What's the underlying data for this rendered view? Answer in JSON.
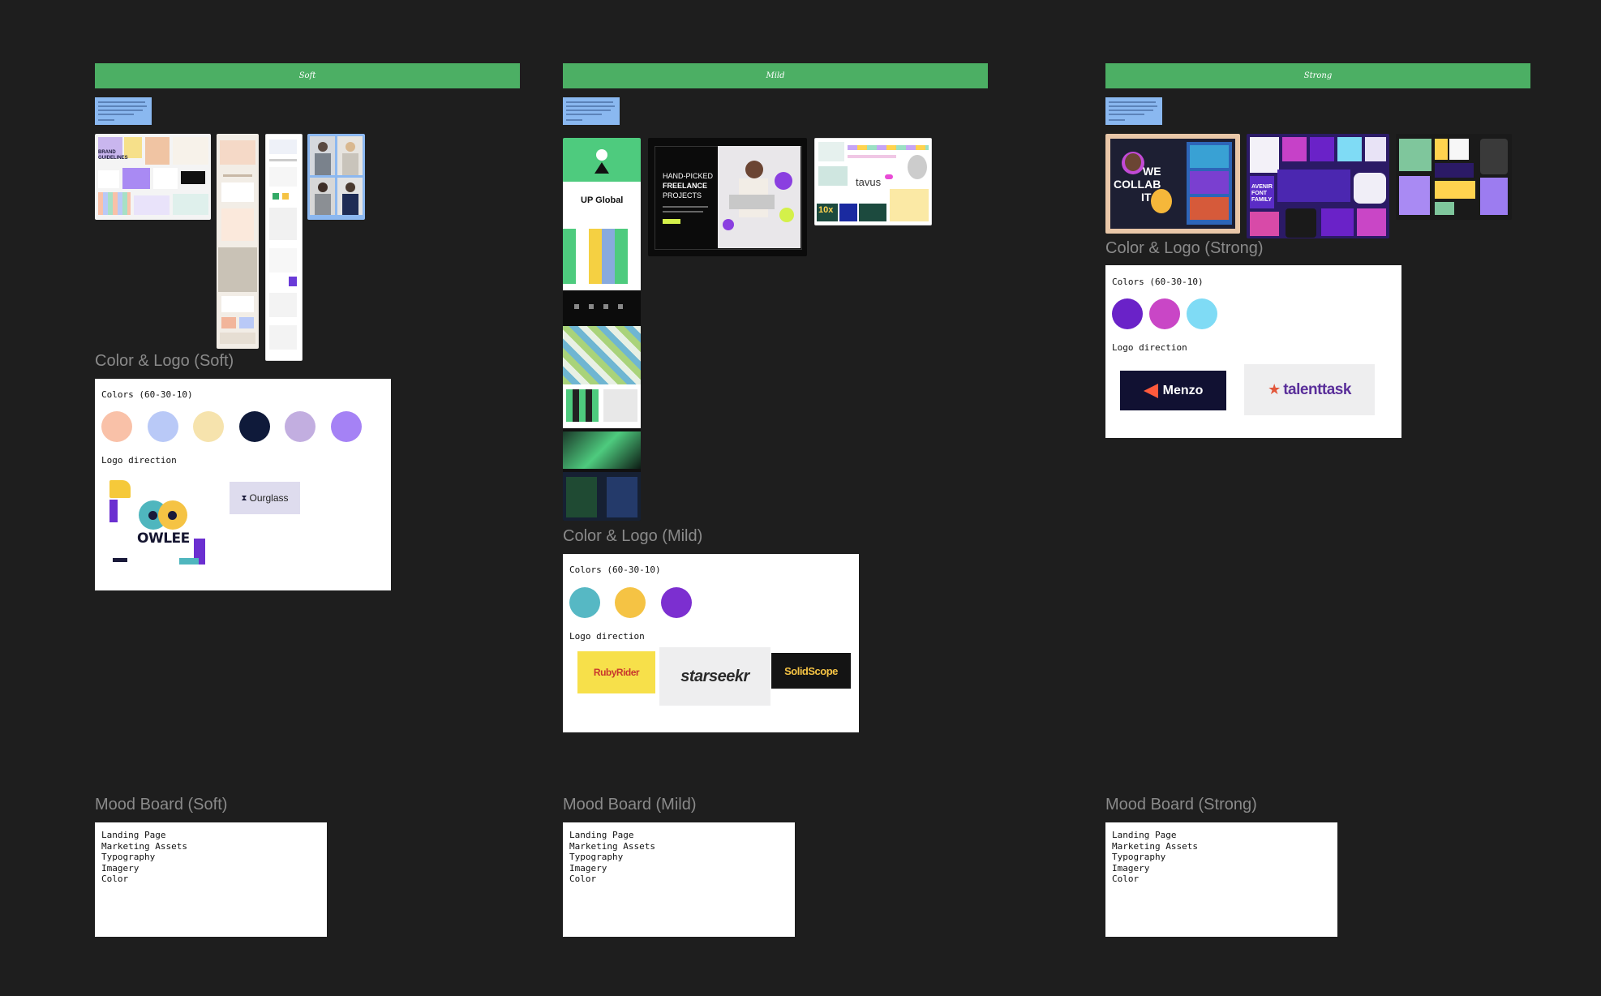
{
  "columns": [
    {
      "banner": "Soft",
      "color_logo_title": "Color & Logo (Soft)",
      "colors_label": "Colors (60-30-10)",
      "logo_label": "Logo direction",
      "colors": [
        "#f9c1a8",
        "#b9c9f7",
        "#f6e3ad",
        "#0f1a3a",
        "#c2aee0",
        "#a582f5"
      ],
      "logos": [
        "OWLEE",
        "Ourglass"
      ],
      "mood_title": "Mood Board (Soft)",
      "mood_items": [
        "Landing Page",
        "Marketing Assets",
        "Typography",
        "Imagery",
        "Color"
      ]
    },
    {
      "banner": "Mild",
      "color_logo_title": "Color & Logo (Mild)",
      "colors_label": "Colors (60-30-10)",
      "logo_label": "Logo direction",
      "colors": [
        "#56b8c4",
        "#f5c344",
        "#7c2fd0"
      ],
      "logos": [
        "RubyRider",
        "starseekr",
        "SolidScope"
      ],
      "mood_title": "Mood Board (Mild)",
      "mood_items": [
        "Landing Page",
        "Marketing Assets",
        "Typography",
        "Imagery",
        "Color"
      ]
    },
    {
      "banner": "Strong",
      "color_logo_title": "Color & Logo (Strong)",
      "colors_label": "Colors (60-30-10)",
      "logo_label": "Logo direction",
      "colors": [
        "#6a22c8",
        "#c946c6",
        "#7fdbf5"
      ],
      "logos": [
        "Menzo",
        "talenttask"
      ],
      "mood_title": "Mood Board (Strong)",
      "mood_items": [
        "Landing Page",
        "Marketing Assets",
        "Typography",
        "Imagery",
        "Color"
      ]
    }
  ],
  "thumb_text": {
    "brand_guidelines": "BRAND GUIDELINES",
    "up_global": "UP Global",
    "hand_picked_1": "HAND-PICKED",
    "hand_picked_2": "FREELANCE",
    "hand_picked_3": "PROJECTS",
    "tavus": "tavus",
    "tavus_10x": "10x",
    "we_collab_1": "WE",
    "we_collab_2": "COLLAB",
    "we_collab_3": "IT",
    "avenir": "AVENIR FONT FAMILY"
  }
}
